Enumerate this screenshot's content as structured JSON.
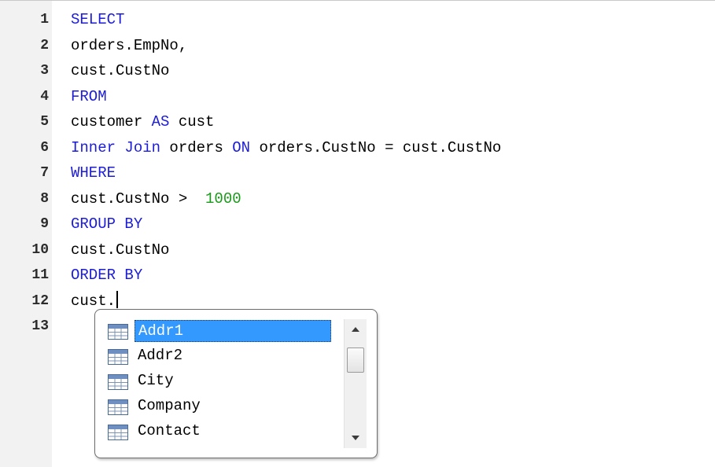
{
  "editor": {
    "lines": [
      {
        "num": "1",
        "segments": [
          {
            "text": "SELECT",
            "type": "kw"
          }
        ]
      },
      {
        "num": "2",
        "segments": [
          {
            "text": "orders.EmpNo,",
            "type": "plain"
          }
        ]
      },
      {
        "num": "3",
        "segments": [
          {
            "text": "cust.CustNo",
            "type": "plain"
          }
        ]
      },
      {
        "num": "4",
        "segments": [
          {
            "text": "FROM",
            "type": "kw"
          }
        ]
      },
      {
        "num": "5",
        "segments": [
          {
            "text": "customer ",
            "type": "plain"
          },
          {
            "text": "AS",
            "type": "kw"
          },
          {
            "text": " cust",
            "type": "plain"
          }
        ]
      },
      {
        "num": "6",
        "segments": [
          {
            "text": "Inner Join",
            "type": "kw"
          },
          {
            "text": " orders ",
            "type": "plain"
          },
          {
            "text": "ON",
            "type": "kw"
          },
          {
            "text": " orders.CustNo = cust.CustNo",
            "type": "plain"
          }
        ]
      },
      {
        "num": "7",
        "segments": [
          {
            "text": "WHERE",
            "type": "kw"
          }
        ]
      },
      {
        "num": "8",
        "segments": [
          {
            "text": "cust.CustNo >  ",
            "type": "plain"
          },
          {
            "text": "1000",
            "type": "num"
          }
        ]
      },
      {
        "num": "9",
        "segments": [
          {
            "text": "GROUP BY",
            "type": "kw"
          }
        ]
      },
      {
        "num": "10",
        "segments": [
          {
            "text": "cust.CustNo",
            "type": "plain"
          }
        ]
      },
      {
        "num": "11",
        "segments": [
          {
            "text": "ORDER BY",
            "type": "kw"
          }
        ]
      },
      {
        "num": "12",
        "segments": [
          {
            "text": "cust.",
            "type": "plain"
          }
        ],
        "caret": true
      },
      {
        "num": "13",
        "segments": []
      }
    ]
  },
  "autocomplete": {
    "selected_index": 0,
    "items": [
      {
        "label": "Addr1",
        "icon": "table-column-icon"
      },
      {
        "label": "Addr2",
        "icon": "table-column-icon"
      },
      {
        "label": "City",
        "icon": "table-column-icon"
      },
      {
        "label": "Company",
        "icon": "table-column-icon"
      },
      {
        "label": "Contact",
        "icon": "table-column-icon"
      }
    ],
    "scrollbar": {
      "up_icon": "scroll-up-arrow-icon",
      "down_icon": "scroll-down-arrow-icon"
    }
  },
  "colors": {
    "keyword": "#1d1dd6",
    "number": "#1a9a1a",
    "selection": "#3399ff",
    "gutter": "#f2f2f2"
  }
}
